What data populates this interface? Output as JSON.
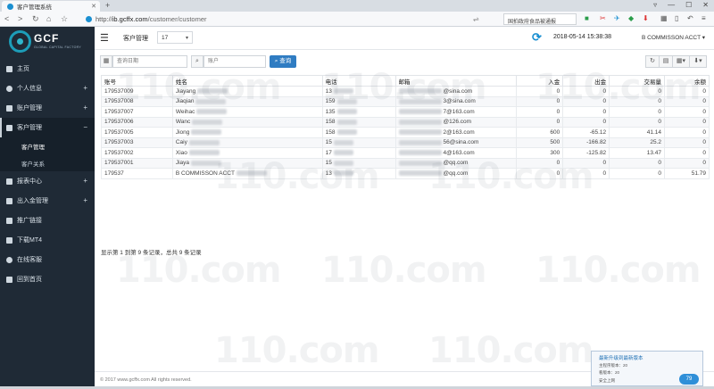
{
  "browser": {
    "tab_title": "客户管理系统",
    "url_scheme": "http://",
    "url_host": "ib.gcffx.com",
    "url_path": "/customer/customer",
    "search_text": "国拍政府食品被通报"
  },
  "brand": {
    "name": "GCF",
    "tagline": "GLOBAL CAPITAL FACTORY"
  },
  "sidebar": {
    "items": [
      {
        "label": "主页",
        "has_children": false
      },
      {
        "label": "个人信息",
        "has_children": true
      },
      {
        "label": "账户管理",
        "has_children": true
      },
      {
        "label": "客户管理",
        "has_children": true,
        "expanded": true
      },
      {
        "label": "报表中心",
        "has_children": true
      },
      {
        "label": "出入金管理",
        "has_children": true
      },
      {
        "label": "推广链接",
        "has_children": false
      },
      {
        "label": "下载MT4",
        "has_children": false
      },
      {
        "label": "在线客服",
        "has_children": false
      },
      {
        "label": "回到首页",
        "has_children": false
      }
    ],
    "subitems": [
      {
        "label": "客户管理",
        "current": true
      },
      {
        "label": "客户关系",
        "current": false
      }
    ]
  },
  "header": {
    "crumb": "客户管理",
    "account_select": "17",
    "datetime": "2018-05-14 15:38:38",
    "account_name": "B COMMISSON ACCT ▾"
  },
  "filters": {
    "date_placeholder": "查询日期",
    "account_placeholder": "账户",
    "query_label": "查询"
  },
  "table": {
    "headers": [
      "账号",
      "姓名",
      "电话",
      "邮箱",
      "入金",
      "出金",
      "交易量",
      "余额"
    ],
    "rows": [
      {
        "account": "179537009",
        "name": "Jiayang",
        "phone": "13",
        "email": "@sina.com",
        "deposit": "0",
        "withdraw": "0",
        "volume": "0",
        "balance": "0"
      },
      {
        "account": "179537008",
        "name": "Jiaqian",
        "phone": "159",
        "email": "3@sina.com",
        "deposit": "0",
        "withdraw": "0",
        "volume": "0",
        "balance": "0"
      },
      {
        "account": "179537007",
        "name": "Weihac",
        "phone": "135",
        "email": "7@163.com",
        "deposit": "0",
        "withdraw": "0",
        "volume": "0",
        "balance": "0"
      },
      {
        "account": "179537006",
        "name": "Wanc",
        "phone": "158",
        "email": "@126.com",
        "deposit": "0",
        "withdraw": "0",
        "volume": "0",
        "balance": "0"
      },
      {
        "account": "179537005",
        "name": "Jiong",
        "phone": "158",
        "email": "2@163.com",
        "deposit": "600",
        "withdraw": "-65.12",
        "volume": "41.14",
        "balance": "0"
      },
      {
        "account": "179537003",
        "name": "Caiy",
        "phone": "15",
        "email": "56@sina.com",
        "deposit": "500",
        "withdraw": "-166.82",
        "volume": "25.2",
        "balance": "0"
      },
      {
        "account": "179537002",
        "name": "Xiao",
        "phone": "17",
        "email": "4@163.com",
        "deposit": "300",
        "withdraw": "-125.82",
        "volume": "13.47",
        "balance": "0"
      },
      {
        "account": "179537001",
        "name": "Jiaya",
        "phone": "15",
        "email": "@qq.com",
        "deposit": "0",
        "withdraw": "0",
        "volume": "0",
        "balance": "0"
      },
      {
        "account": "179537",
        "name": "B COMMISSON ACCT",
        "phone": "13",
        "email": "@qq.com",
        "deposit": "0",
        "withdraw": "0",
        "volume": "0",
        "balance": "51.79"
      }
    ]
  },
  "summary": "显示第 1 到第 9 条记录，总共 9 条记录",
  "footer": "© 2017 www.gcffx.com All rights reserved.",
  "watermark": "110.com",
  "notification": {
    "title": "最新升级到最新版本",
    "line1": "主程序版本：20",
    "line2": "看版本：20",
    "line3": "安全上网",
    "badge": "79"
  },
  "colors": {
    "sidebar_bg": "#1f2a36",
    "accent": "#2f7cc2"
  }
}
